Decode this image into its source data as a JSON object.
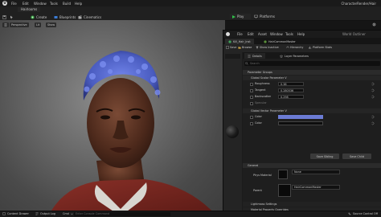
{
  "editor": {
    "menu": [
      "File",
      "Edit",
      "Window",
      "Tools",
      "Build",
      "Help"
    ],
    "project_name": "CharacterRender/Hair",
    "level_tab": "Hairlooms",
    "toolbar": {
      "save": "",
      "create": "Create",
      "blueprints": "Blueprints",
      "cinematics": "Cinematics",
      "play": "Play",
      "platforms": "Platforms",
      "settings": "Settings"
    },
    "viewport_buttons": [
      "Perspective",
      "Lit",
      "Show"
    ]
  },
  "material_editor": {
    "menu": [
      "File",
      "Edit",
      "Asset",
      "Window",
      "Tools",
      "Help"
    ],
    "tabs": [
      {
        "label": "Kill_Hair_Inst"
      },
      {
        "label": "HairCommonMaster"
      }
    ],
    "world_outliner_label": "World Outliner",
    "toolbar": {
      "save": "Save",
      "browse": "Browse",
      "show_inactive": "Show Inactive",
      "hierarchy": "Hierarchy",
      "platform_stats": "Platform Stats"
    },
    "details_tabs": [
      "Details",
      "Layer Parameters"
    ],
    "search_placeholder": "Search",
    "sections": {
      "parameter_groups": "Parameter Groups",
      "global_scalar": "Global Scalar Parameter V",
      "global_vector": "Global Vector Parameter V",
      "general": "General",
      "lightmass": "Lightmass Settings",
      "material_property_overrides": "Material Property Overrides",
      "previewing": "Previewing"
    },
    "scalar_params": [
      {
        "label": "Roughness",
        "value": "0.38"
      },
      {
        "label": "Tangent",
        "value": "0.280536"
      },
      {
        "label": "Backscatter",
        "value": "0.298"
      },
      {
        "label": "Specular",
        "value": ""
      }
    ],
    "vector_params": [
      {
        "label": "Color",
        "color": "#6b7bd4"
      },
      {
        "label": "Color",
        "color": "#0d0d0d"
      }
    ],
    "buttons": {
      "save_sibling": "Save Sibling",
      "save_child": "Save Child"
    },
    "general": {
      "phys_material_label": "Phys Material",
      "phys_material_value": "None",
      "parent_label": "Parent",
      "parent_value": "HairCommonMaster"
    }
  },
  "statusbar": {
    "content_drawer": "Content Drawer",
    "output_log": "Output Log",
    "cmd": "Cmd",
    "console_placeholder": "Enter Console Command",
    "source_control": "Source Control Off"
  },
  "colors": {
    "accent_play": "#32c24a",
    "hair_blue": "#5b6fd8",
    "vector_color": "#6b7bd4"
  }
}
